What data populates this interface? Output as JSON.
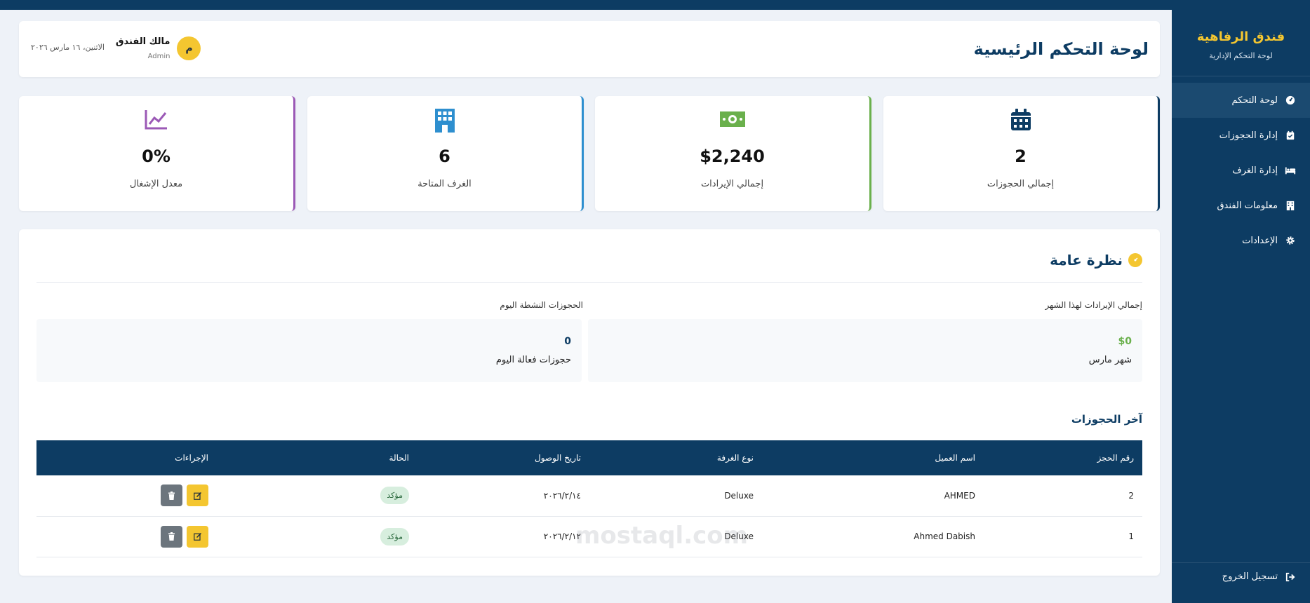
{
  "sidebar": {
    "brand_title": "فندق الرفاهية",
    "brand_subtitle": "لوحة التحكم الإدارية",
    "items": [
      {
        "label": "لوحة التحكم",
        "icon": "speedometer-icon",
        "active": true
      },
      {
        "label": "إدارة الحجوزات",
        "icon": "calendar-check-icon",
        "active": false
      },
      {
        "label": "إدارة الغرف",
        "icon": "bed-icon",
        "active": false
      },
      {
        "label": "معلومات الفندق",
        "icon": "building-icon",
        "active": false
      },
      {
        "label": "الإعدادات",
        "icon": "gear-icon",
        "active": false
      }
    ],
    "logout_label": "تسجيل الخروج"
  },
  "header": {
    "title": "لوحة التحكم الرئيسية",
    "user_name": "مالك الفندق",
    "user_role": "Admin",
    "avatar_letter": "م",
    "date": "الاثنين، ١٦ مارس ٢٠٢٦"
  },
  "stats": [
    {
      "value": "2",
      "label": "إجمالي الحجوزات",
      "icon": "calendar-icon",
      "color": "#0d3c63"
    },
    {
      "value": "$2,240",
      "label": "إجمالي الإيرادات",
      "icon": "money-icon",
      "color": "#6ab04c"
    },
    {
      "value": "6",
      "label": "الغرف المتاحة",
      "icon": "building-icon",
      "color": "#2e8fcf"
    },
    {
      "value": "0%",
      "label": "معدل الإشغال",
      "icon": "chart-line-icon",
      "color": "#9b59b6"
    }
  ],
  "overview": {
    "title": "نظرة عامة",
    "revenue_label": "إجمالي الإيرادات لهذا الشهر",
    "revenue_value": "$0",
    "revenue_sub": "شهر مارس",
    "active_label": "الحجوزات النشطة اليوم",
    "active_value": "0",
    "active_sub": "حجوزات فعالة اليوم"
  },
  "recent": {
    "title": "آخر الحجوزات",
    "columns": [
      "رقم الحجز",
      "اسم العميل",
      "نوع الغرفة",
      "تاريخ الوصول",
      "الحالة",
      "الإجراءات"
    ],
    "rows": [
      {
        "id": "2",
        "customer": "AHMED",
        "room": "Deluxe",
        "date": "٢٠٢٦/٢/١٤",
        "status": "مؤكد"
      },
      {
        "id": "1",
        "customer": "Ahmed Dabish",
        "room": "Deluxe",
        "date": "٢٠٢٦/٢/١٢",
        "status": "مؤكد"
      }
    ]
  },
  "colors": {
    "primary": "#0d3c63",
    "accent": "#f4c630",
    "success": "#6ab04c",
    "info": "#2e8fcf",
    "purple": "#9b59b6"
  },
  "watermark": "mostaql.com"
}
